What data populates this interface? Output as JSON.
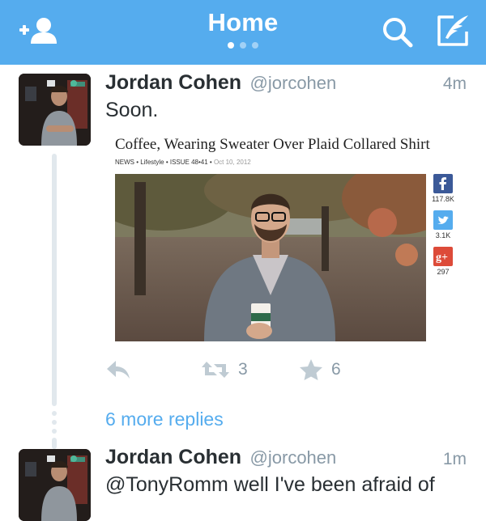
{
  "navbar": {
    "title": "Home",
    "page_count": 3,
    "active_page": 1,
    "background": "#55acee",
    "left_icon": "add-user-icon",
    "right_icons": [
      "search-icon",
      "compose-tweet-icon"
    ]
  },
  "tweets": [
    {
      "author_name": "Jordan Cohen",
      "author_handle": "@jorcohen",
      "timestamp": "4m",
      "text": "Soon.",
      "media": {
        "headline": "Coffee, Wearing Sweater Over Plaid Collared Shirt",
        "meta": "NEWS • Lifestyle • ISSUE 48•41 •",
        "date": "Oct 10, 2012",
        "share": [
          {
            "network": "facebook",
            "icon": "facebook-icon",
            "count": "117.8K",
            "color": "#3b5998"
          },
          {
            "network": "twitter",
            "icon": "twitter-icon",
            "count": "3.1K",
            "color": "#55acee"
          },
          {
            "network": "google-plus",
            "icon": "google-plus-icon",
            "count": "297",
            "color": "#dd4b39"
          }
        ]
      },
      "actions": {
        "reply_icon": "reply-icon",
        "retweet_icon": "retweet-icon",
        "retweet_count": "3",
        "favorite_icon": "star-icon",
        "favorite_count": "6"
      }
    },
    {
      "author_name": "Jordan Cohen",
      "author_handle": "@jorcohen",
      "timestamp": "1m",
      "text": "@TonyRomm well I've been afraid of"
    }
  ],
  "more_replies": "6 more replies",
  "colors": {
    "accent": "#55acee",
    "text": "#292f33",
    "muted": "#8899a6",
    "action_icon": "#bfcbd3",
    "thread_line": "#e1e8ed"
  }
}
